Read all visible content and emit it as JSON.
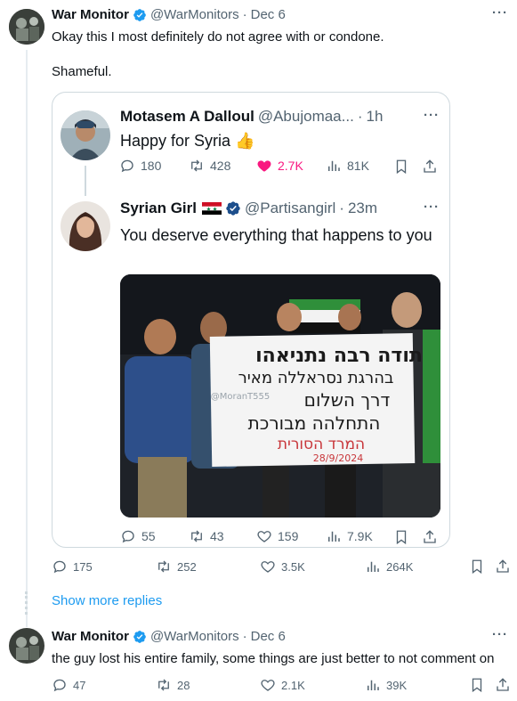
{
  "tweet1": {
    "display_name": "War Monitor",
    "handle": "@WarMonitors",
    "separator": "·",
    "date": "Dec 6",
    "text_line1": "Okay this I most definitely do not agree with or condone.",
    "text_line2": "Shameful.",
    "replies": "175",
    "retweets": "252",
    "likes": "3.5K",
    "views": "264K"
  },
  "quote": {
    "parent": {
      "display_name": "Motasem A Dalloul",
      "handle": "@Abujomaa...",
      "separator": "·",
      "time": "1h",
      "text": "Happy for Syria",
      "emoji": "👍",
      "replies": "180",
      "retweets": "428",
      "likes": "2.7K",
      "views": "81K"
    },
    "reply": {
      "display_name": "Syrian Girl",
      "handle": "@Partisangirl",
      "separator": "·",
      "time": "23m",
      "text": "You deserve everything that happens to you",
      "replies": "55",
      "retweets": "43",
      "likes": "159",
      "views": "7.9K"
    },
    "photo": {
      "sign_line1": "תודה רבה נתניאהו",
      "sign_line2": "בהרגת נסראללה מאיר",
      "sign_line3": "דרך השלום",
      "sign_line4": "התחלהה מבורכת",
      "sign_line5": "המרד הסורית",
      "sign_date": "28/9/2024",
      "watermark": "@MoranT555"
    }
  },
  "show_more": "Show more replies",
  "tweet2": {
    "display_name": "War Monitor",
    "handle": "@WarMonitors",
    "separator": "·",
    "date": "Dec 6",
    "text": "the guy lost his entire family, some things are just better to not comment on",
    "replies": "47",
    "retweets": "28",
    "likes": "2.1K",
    "views": "39K"
  },
  "colors": {
    "accent": "#1d9bf0",
    "like_active": "#f91880",
    "muted": "#536471",
    "border": "#cfd9de"
  },
  "icons": [
    "avatar",
    "verified-badge-icon",
    "more-icon",
    "reply-icon",
    "retweet-icon",
    "like-icon",
    "views-icon",
    "bookmark-icon",
    "share-icon",
    "syria-flag-icon"
  ]
}
